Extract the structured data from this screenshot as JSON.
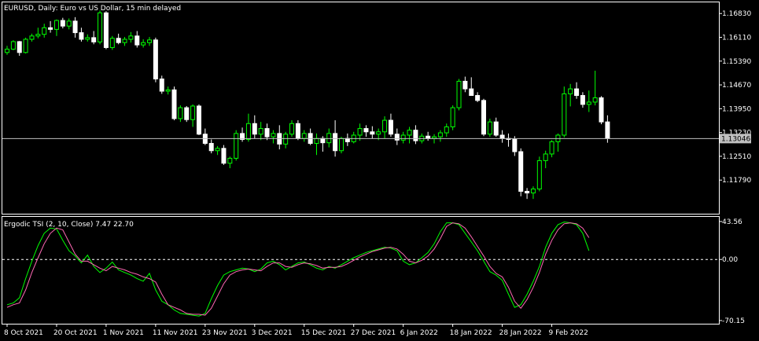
{
  "colors": {
    "background": "#000000",
    "bull": "#00ff00",
    "bear": "#ffffff",
    "frame": "#ffffff",
    "bidline": "#c0c0c0",
    "price_tag_bg": "#c0c0c0",
    "price_tag_text": "#000000",
    "signal_green": "#00ff00",
    "signal_pink": "#ff69b4",
    "zero_line": "#ffffff"
  },
  "main_header": "EURUSD, Daily:  Euro vs US Dollar, 15 min delayed",
  "indicator_header": "Ergodic TSI (2, 10, Close) 7.47 22.70",
  "chart_data": [
    {
      "type": "candlestick",
      "symbol": "EURUSD",
      "timeframe": "Daily",
      "y_ticks": [
        "1.16830",
        "1.16110",
        "1.15390",
        "1.14670",
        "1.13950",
        "1.13230",
        "1.12510",
        "1.11790"
      ],
      "ylim": [
        1.1082,
        1.1712
      ],
      "current_price": "1.13046",
      "x_ticks": [
        {
          "label": "8 Oct 2021",
          "index": 0
        },
        {
          "label": "20 Oct 2021",
          "index": 8
        },
        {
          "label": "1 Nov 2021",
          "index": 16
        },
        {
          "label": "11 Nov 2021",
          "index": 24
        },
        {
          "label": "23 Nov 2021",
          "index": 32
        },
        {
          "label": "3 Dec 2021",
          "index": 40
        },
        {
          "label": "15 Dec 2021",
          "index": 48
        },
        {
          "label": "27 Dec 2021",
          "index": 56
        },
        {
          "label": "6 Jan 2022",
          "index": 64
        },
        {
          "label": "18 Jan 2022",
          "index": 72
        },
        {
          "label": "28 Jan 2022",
          "index": 80
        },
        {
          "label": "9 Feb 2022",
          "index": 88
        }
      ],
      "candles": [
        [
          1.1565,
          1.1585,
          1.1558,
          1.1575
        ],
        [
          1.1575,
          1.1602,
          1.1572,
          1.1598
        ],
        [
          1.1598,
          1.16,
          1.1555,
          1.1565
        ],
        [
          1.1565,
          1.161,
          1.1562,
          1.1605
        ],
        [
          1.1605,
          1.1622,
          1.1598,
          1.1615
        ],
        [
          1.1615,
          1.164,
          1.1608,
          1.162
        ],
        [
          1.162,
          1.1652,
          1.161,
          1.164
        ],
        [
          1.164,
          1.166,
          1.1625,
          1.1635
        ],
        [
          1.1635,
          1.1665,
          1.1615,
          1.1662
        ],
        [
          1.1662,
          1.167,
          1.1638,
          1.1645
        ],
        [
          1.1645,
          1.1668,
          1.1635,
          1.166
        ],
        [
          1.166,
          1.1672,
          1.161,
          1.1625
        ],
        [
          1.1625,
          1.164,
          1.1598,
          1.1605
        ],
        [
          1.1605,
          1.162,
          1.1598,
          1.161
        ],
        [
          1.161,
          1.163,
          1.159,
          1.1597
        ],
        [
          1.1597,
          1.1692,
          1.159,
          1.1685
        ],
        [
          1.1685,
          1.169,
          1.1575,
          1.158
        ],
        [
          1.158,
          1.1615,
          1.1573,
          1.1608
        ],
        [
          1.1608,
          1.1622,
          1.159,
          1.1595
        ],
        [
          1.1595,
          1.1612,
          1.1585,
          1.1605
        ],
        [
          1.1605,
          1.1627,
          1.1595,
          1.1615
        ],
        [
          1.1615,
          1.163,
          1.158,
          1.1588
        ],
        [
          1.1588,
          1.1605,
          1.158,
          1.1595
        ],
        [
          1.1595,
          1.1612,
          1.1585,
          1.1603
        ],
        [
          1.1603,
          1.161,
          1.1475,
          1.1485
        ],
        [
          1.1485,
          1.1495,
          1.144,
          1.1448
        ],
        [
          1.1448,
          1.1462,
          1.1438,
          1.1452
        ],
        [
          1.1452,
          1.1462,
          1.136,
          1.1365
        ],
        [
          1.1365,
          1.1405,
          1.1355,
          1.1398
        ],
        [
          1.1398,
          1.1403,
          1.1355,
          1.1362
        ],
        [
          1.1362,
          1.1408,
          1.134,
          1.1403
        ],
        [
          1.1403,
          1.1408,
          1.1315,
          1.1318
        ],
        [
          1.1318,
          1.1335,
          1.1285,
          1.129
        ],
        [
          1.129,
          1.1302,
          1.126,
          1.1268
        ],
        [
          1.1268,
          1.1282,
          1.1255,
          1.1275
        ],
        [
          1.1275,
          1.1285,
          1.1225,
          1.123
        ],
        [
          1.123,
          1.125,
          1.1215,
          1.1245
        ],
        [
          1.1245,
          1.133,
          1.1238,
          1.132
        ],
        [
          1.132,
          1.1338,
          1.1295,
          1.1302
        ],
        [
          1.1302,
          1.138,
          1.1295,
          1.135
        ],
        [
          1.135,
          1.1375,
          1.1305,
          1.1318
        ],
        [
          1.1318,
          1.1355,
          1.13,
          1.1335
        ],
        [
          1.1335,
          1.135,
          1.13,
          1.131
        ],
        [
          1.131,
          1.133,
          1.129,
          1.132
        ],
        [
          1.132,
          1.1345,
          1.1272,
          1.1288
        ],
        [
          1.1288,
          1.1325,
          1.1275,
          1.1318
        ],
        [
          1.1318,
          1.136,
          1.131,
          1.135
        ],
        [
          1.135,
          1.136,
          1.13,
          1.1305
        ],
        [
          1.1305,
          1.133,
          1.1295,
          1.132
        ],
        [
          1.132,
          1.1335,
          1.1285,
          1.129
        ],
        [
          1.129,
          1.132,
          1.1255,
          1.1305
        ],
        [
          1.1305,
          1.1312,
          1.1265,
          1.1292
        ],
        [
          1.1292,
          1.1335,
          1.1278,
          1.132
        ],
        [
          1.132,
          1.136,
          1.125,
          1.1268
        ],
        [
          1.1268,
          1.131,
          1.126,
          1.1305
        ],
        [
          1.1305,
          1.132,
          1.1282,
          1.1295
        ],
        [
          1.1295,
          1.1325,
          1.129,
          1.1315
        ],
        [
          1.1315,
          1.135,
          1.1298,
          1.1335
        ],
        [
          1.1335,
          1.1345,
          1.131,
          1.1325
        ],
        [
          1.1325,
          1.1342,
          1.1305,
          1.1318
        ],
        [
          1.1318,
          1.1335,
          1.13,
          1.1325
        ],
        [
          1.1325,
          1.1372,
          1.1305,
          1.136
        ],
        [
          1.136,
          1.138,
          1.131,
          1.1318
        ],
        [
          1.1318,
          1.1335,
          1.1285,
          1.13
        ],
        [
          1.13,
          1.1325,
          1.129,
          1.1315
        ],
        [
          1.1315,
          1.134,
          1.129,
          1.133
        ],
        [
          1.133,
          1.1345,
          1.1288,
          1.1298
        ],
        [
          1.1298,
          1.132,
          1.129,
          1.1312
        ],
        [
          1.1312,
          1.1325,
          1.1298,
          1.1305
        ],
        [
          1.1305,
          1.1318,
          1.129,
          1.131
        ],
        [
          1.131,
          1.133,
          1.1295,
          1.1322
        ],
        [
          1.1322,
          1.135,
          1.131,
          1.134
        ],
        [
          1.134,
          1.1405,
          1.133,
          1.1398
        ],
        [
          1.1398,
          1.1485,
          1.139,
          1.1478
        ],
        [
          1.1478,
          1.1492,
          1.1445,
          1.1455
        ],
        [
          1.1455,
          1.149,
          1.1435,
          1.1435
        ],
        [
          1.1435,
          1.1445,
          1.1415,
          1.142
        ],
        [
          1.142,
          1.1425,
          1.1312,
          1.1318
        ],
        [
          1.1318,
          1.1365,
          1.131,
          1.1355
        ],
        [
          1.1355,
          1.1368,
          1.131,
          1.1315
        ],
        [
          1.1315,
          1.133,
          1.1292,
          1.1305
        ],
        [
          1.1305,
          1.132,
          1.128,
          1.1302
        ],
        [
          1.1302,
          1.1312,
          1.1252,
          1.1265
        ],
        [
          1.1265,
          1.1275,
          1.113,
          1.1145
        ],
        [
          1.1145,
          1.1155,
          1.1122,
          1.114
        ],
        [
          1.114,
          1.116,
          1.1122,
          1.1152
        ],
        [
          1.1152,
          1.125,
          1.1145,
          1.1238
        ],
        [
          1.1238,
          1.1268,
          1.1215,
          1.1258
        ],
        [
          1.1258,
          1.13,
          1.1248,
          1.1295
        ],
        [
          1.1295,
          1.132,
          1.1265,
          1.1315
        ],
        [
          1.1315,
          1.1462,
          1.1308,
          1.144
        ],
        [
          1.144,
          1.147,
          1.1402,
          1.1455
        ],
        [
          1.1455,
          1.1475,
          1.1425,
          1.1435
        ],
        [
          1.1435,
          1.1445,
          1.1398,
          1.1408
        ],
        [
          1.1408,
          1.145,
          1.1385,
          1.1415
        ],
        [
          1.1415,
          1.151,
          1.1405,
          1.1428
        ],
        [
          1.1428,
          1.1433,
          1.1348,
          1.1355
        ],
        [
          1.1355,
          1.1375,
          1.1292,
          1.1305
        ]
      ]
    },
    {
      "type": "line",
      "name": "Ergodic TSI (2, 10, Close)",
      "y_ticks": [
        "43.56",
        "0.00",
        "-70.15"
      ],
      "ylim": [
        -72,
        48
      ],
      "zero_line": 0.0,
      "series": [
        {
          "values": [
            -52,
            -50,
            -44,
            -22,
            -2,
            16,
            30,
            36,
            35,
            22,
            10,
            4,
            -4,
            5,
            -8,
            -15,
            -10,
            -3,
            -12,
            -15,
            -18,
            -22,
            -25,
            -16,
            -35,
            -48,
            -52,
            -58,
            -62,
            -63,
            -64,
            -65,
            -62,
            -45,
            -30,
            -18,
            -14,
            -12,
            -10,
            -11,
            -14,
            -11,
            -4,
            -2,
            -6,
            -12,
            -8,
            -4,
            -3,
            -6,
            -10,
            -12,
            -8,
            -10,
            -6,
            -2,
            2,
            5,
            8,
            10,
            12,
            14,
            13,
            10,
            -2,
            -6,
            -4,
            2,
            8,
            18,
            32,
            42,
            42,
            40,
            30,
            20,
            10,
            -2,
            -14,
            -18,
            -24,
            -40,
            -55,
            -52,
            -40,
            -25,
            -8,
            14,
            30,
            40,
            43,
            42,
            40,
            30,
            10
          ]
        },
        {
          "values": [
            -55,
            -52,
            -50,
            -35,
            -15,
            2,
            18,
            30,
            36,
            34,
            20,
            6,
            -2,
            -2,
            -6,
            -10,
            -13,
            -8,
            -10,
            -12,
            -15,
            -17,
            -20,
            -22,
            -26,
            -40,
            -52,
            -55,
            -58,
            -62,
            -63,
            -63,
            -64,
            -56,
            -42,
            -28,
            -18,
            -14,
            -12,
            -11,
            -12,
            -13,
            -8,
            -4,
            -4,
            -8,
            -9,
            -6,
            -4,
            -5,
            -7,
            -10,
            -9,
            -9,
            -8,
            -5,
            -1,
            3,
            6,
            9,
            11,
            13,
            14,
            12,
            6,
            -2,
            -4,
            -1,
            4,
            12,
            24,
            38,
            42,
            41,
            36,
            26,
            15,
            4,
            -8,
            -16,
            -20,
            -32,
            -48,
            -56,
            -46,
            -32,
            -15,
            6,
            22,
            34,
            41,
            42,
            41,
            36,
            25
          ]
        }
      ]
    }
  ]
}
